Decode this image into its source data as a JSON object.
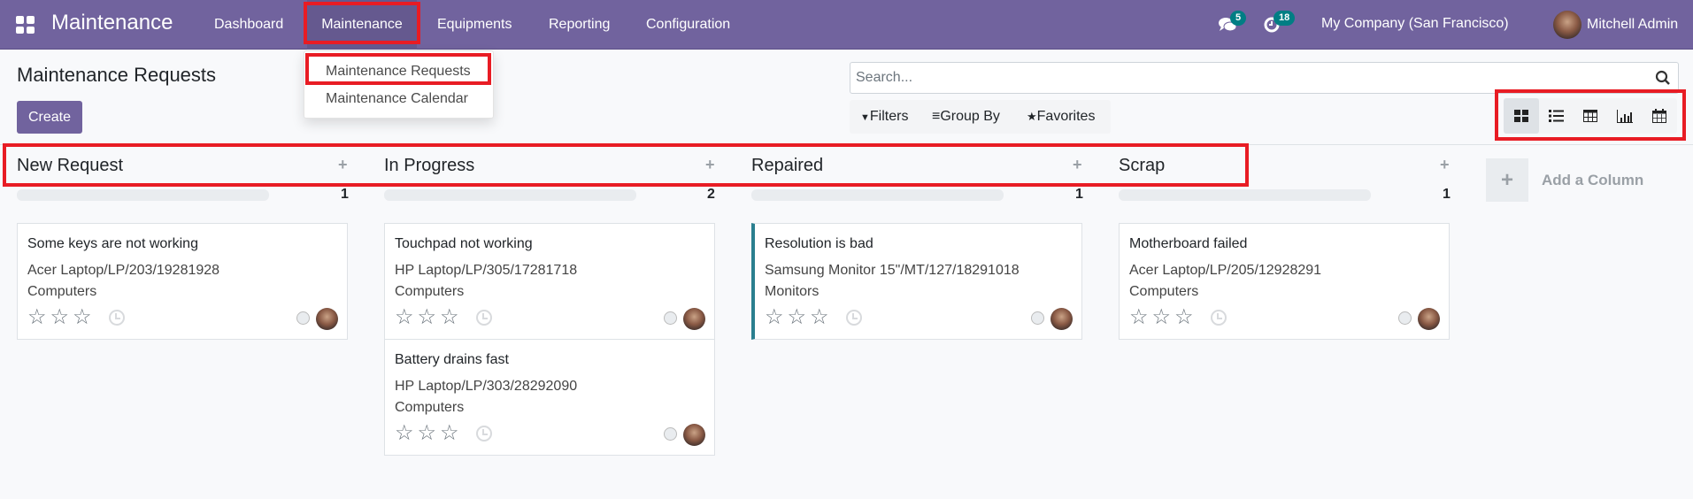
{
  "navbar": {
    "app_name": "Maintenance",
    "menu": [
      {
        "label": "Dashboard"
      },
      {
        "label": "Maintenance",
        "active": true
      },
      {
        "label": "Equipments"
      },
      {
        "label": "Reporting"
      },
      {
        "label": "Configuration"
      }
    ],
    "messages_count": "5",
    "activities_count": "18",
    "company": "My Company (San Francisco)",
    "user": "Mitchell Admin"
  },
  "dropdown": {
    "items": [
      {
        "label": "Maintenance Requests",
        "highlighted": true
      },
      {
        "label": "Maintenance Calendar"
      }
    ]
  },
  "page": {
    "title": "Maintenance Requests",
    "create_label": "Create"
  },
  "search": {
    "placeholder": "Search...",
    "value": ""
  },
  "filters": {
    "filters_label": "Filters",
    "groupby_label": "Group By",
    "favorites_label": "Favorites"
  },
  "views": [
    {
      "name": "kanban",
      "active": true
    },
    {
      "name": "list"
    },
    {
      "name": "pivot"
    },
    {
      "name": "graph"
    },
    {
      "name": "calendar"
    }
  ],
  "columns": [
    {
      "title": "New Request",
      "count": "1",
      "cards": [
        {
          "title": "Some keys are not working",
          "equipment": "Acer Laptop/LP/203/19281928",
          "category": "Computers",
          "priority": 0
        }
      ]
    },
    {
      "title": "In Progress",
      "count": "2",
      "cards": [
        {
          "title": "Touchpad not working",
          "equipment": "HP Laptop/LP/305/17281718",
          "category": "Computers",
          "priority": 0
        },
        {
          "title": "Battery drains fast",
          "equipment": "HP Laptop/LP/303/28292090",
          "category": "Computers",
          "priority": 0
        }
      ]
    },
    {
      "title": "Repaired",
      "count": "1",
      "cards": [
        {
          "title": "Resolution is bad",
          "equipment": "Samsung Monitor 15\"/MT/127/18291018",
          "category": "Monitors",
          "priority": 0
        }
      ]
    },
    {
      "title": "Scrap",
      "count": "1",
      "cards": [
        {
          "title": "Motherboard failed",
          "equipment": "Acer Laptop/LP/205/12928291",
          "category": "Computers",
          "priority": 0
        }
      ]
    }
  ],
  "add_column": {
    "label": "Add a Column"
  },
  "colors": {
    "brand": "#71639e",
    "badge": "#017e84",
    "highlight": "#e81c24",
    "repaired_accent": "#2a7f8f"
  }
}
